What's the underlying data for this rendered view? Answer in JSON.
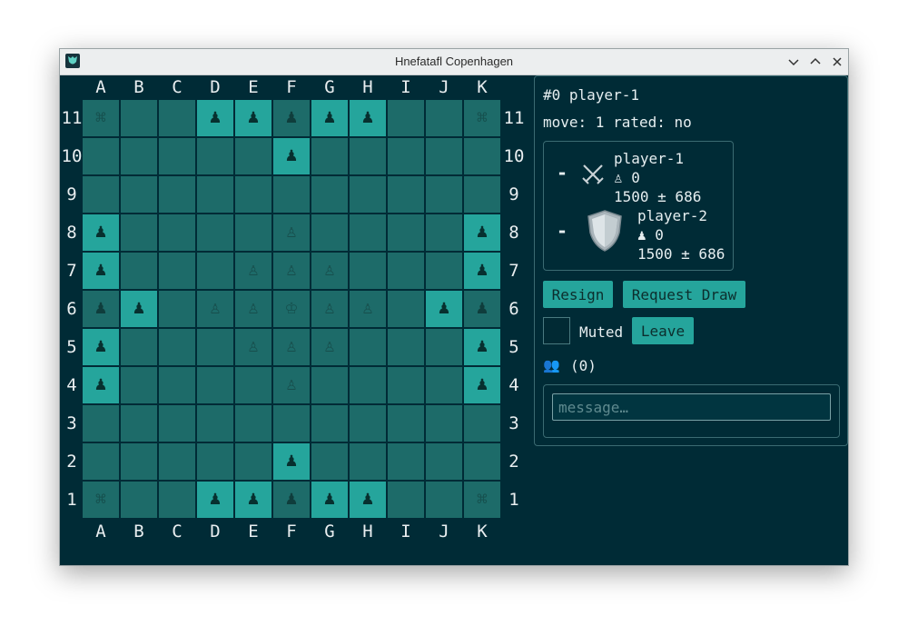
{
  "window": {
    "title": "Hnefatafl Copenhagen"
  },
  "board": {
    "columns": [
      "A",
      "B",
      "C",
      "D",
      "E",
      "F",
      "G",
      "H",
      "I",
      "J",
      "K"
    ],
    "rows": [
      "11",
      "10",
      "9",
      "8",
      "7",
      "6",
      "5",
      "4",
      "3",
      "2",
      "1"
    ],
    "glyphs": {
      "attacker": "♟",
      "defender": "♙",
      "king": "♔",
      "corner": "⌘"
    },
    "pieces": [
      [
        "corner",
        "",
        "",
        "attacker",
        "attacker",
        "attacker-throne",
        "attacker",
        "attacker",
        "",
        "",
        "corner"
      ],
      [
        "",
        "",
        "",
        "",
        "",
        "attacker",
        "",
        "",
        "",
        "",
        ""
      ],
      [
        "",
        "",
        "",
        "",
        "",
        "",
        "",
        "",
        "",
        "",
        ""
      ],
      [
        "attacker",
        "",
        "",
        "",
        "",
        "defender",
        "",
        "",
        "",
        "",
        "attacker"
      ],
      [
        "attacker",
        "",
        "",
        "",
        "defender",
        "defender",
        "defender",
        "",
        "",
        "",
        "attacker"
      ],
      [
        "attacker-throne",
        "attacker",
        "",
        "defender",
        "defender",
        "king",
        "defender",
        "defender",
        "",
        "attacker",
        "attacker-throne"
      ],
      [
        "attacker",
        "",
        "",
        "",
        "defender",
        "defender",
        "defender",
        "",
        "",
        "",
        "attacker"
      ],
      [
        "attacker",
        "",
        "",
        "",
        "",
        "defender",
        "",
        "",
        "",
        "",
        "attacker"
      ],
      [
        "",
        "",
        "",
        "",
        "",
        "",
        "",
        "",
        "",
        "",
        ""
      ],
      [
        "",
        "",
        "",
        "",
        "",
        "attacker",
        "",
        "",
        "",
        "",
        ""
      ],
      [
        "corner",
        "",
        "",
        "attacker",
        "attacker",
        "attacker-throne",
        "attacker",
        "attacker",
        "",
        "",
        "corner"
      ]
    ]
  },
  "panel": {
    "game_id": "#0 player-1",
    "move_line": "move: 1 rated: no",
    "player1": {
      "dash": "-",
      "name": "player-1",
      "captures": "♙ 0",
      "rating": "1500 ± 686",
      "icon": "crossed-swords-icon"
    },
    "player2": {
      "dash": "-",
      "name": "player-2",
      "captures": "♟ 0",
      "rating": "1500 ± 686",
      "icon": "shield-icon"
    },
    "resign_label": "Resign",
    "request_draw_label": "Request Draw",
    "muted_label": "Muted",
    "leave_label": "Leave",
    "spectators_icon": "👥",
    "spectators_count": "(0)",
    "message_placeholder": "message…"
  },
  "colors": {
    "background": "#002b36",
    "square": "#1d6b69",
    "attacker_square": "#25a59c",
    "button": "#25a59c"
  }
}
